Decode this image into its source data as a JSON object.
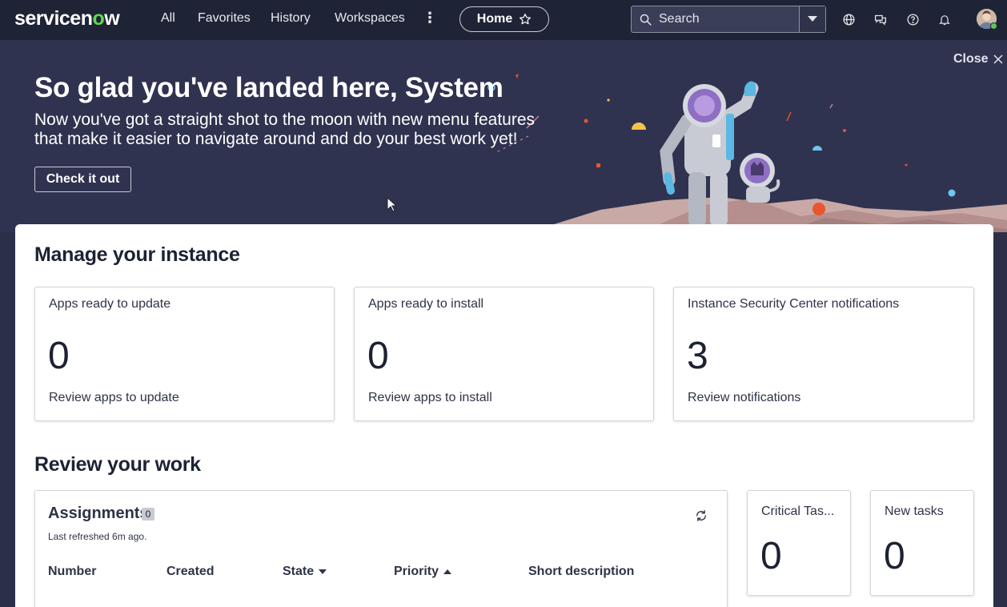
{
  "nav": {
    "logo": {
      "text_main": "servicen",
      "text_o": "o",
      "text_end": "w"
    },
    "links": [
      "All",
      "Favorites",
      "History",
      "Workspaces"
    ],
    "more_label": "⋮",
    "home_label": "Home",
    "search_placeholder": "Search"
  },
  "banner": {
    "title": "So glad you've landed here, System",
    "subtitle": "Now you've got a straight shot to the moon with new menu features that make it easier to navigate around and do your best work yet!",
    "button_label": "Check it out",
    "close_label": "Close"
  },
  "manage": {
    "title": "Manage your instance",
    "cards": [
      {
        "title": "Apps ready to update",
        "count": "0",
        "link": "Review apps to update"
      },
      {
        "title": "Apps ready to install",
        "count": "0",
        "link": "Review apps to install"
      },
      {
        "title": "Instance Security Center notifications",
        "count": "3",
        "link": "Review notifications"
      }
    ]
  },
  "review": {
    "title": "Review your work",
    "assignments": {
      "title": "Assignments",
      "badge": "0",
      "refreshed": "Last refreshed 6m ago.",
      "columns": [
        "Number",
        "Created",
        "State",
        "Priority",
        "Short description"
      ]
    },
    "tiles": [
      {
        "title": "Critical Tas...",
        "count": "0"
      },
      {
        "title": "New tasks",
        "count": "0"
      }
    ]
  },
  "colors": {
    "nav_bg": "#1f2336",
    "banner_bg": "#2f3350",
    "accent_green": "#62d84e"
  }
}
